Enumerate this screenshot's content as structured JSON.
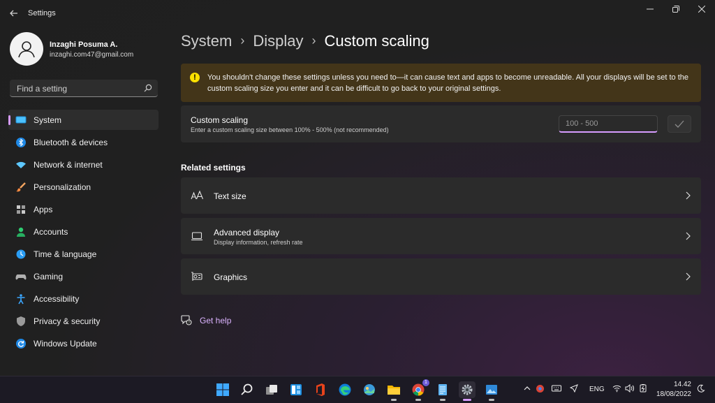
{
  "window": {
    "title": "Settings"
  },
  "profile": {
    "name": "Inzaghi Posuma A.",
    "email": "inzaghi.com47@gmail.com"
  },
  "search": {
    "placeholder": "Find a setting"
  },
  "sidebar": {
    "items": [
      {
        "label": "System",
        "icon": "system-icon",
        "active": true
      },
      {
        "label": "Bluetooth & devices",
        "icon": "bluetooth-icon"
      },
      {
        "label": "Network & internet",
        "icon": "wifi-icon"
      },
      {
        "label": "Personalization",
        "icon": "brush-icon"
      },
      {
        "label": "Apps",
        "icon": "apps-icon"
      },
      {
        "label": "Accounts",
        "icon": "accounts-icon"
      },
      {
        "label": "Time & language",
        "icon": "globe-clock-icon"
      },
      {
        "label": "Gaming",
        "icon": "gamepad-icon"
      },
      {
        "label": "Accessibility",
        "icon": "accessibility-icon"
      },
      {
        "label": "Privacy & security",
        "icon": "shield-icon"
      },
      {
        "label": "Windows Update",
        "icon": "update-icon"
      }
    ]
  },
  "breadcrumb": {
    "items": [
      "System",
      "Display",
      "Custom scaling"
    ]
  },
  "warning": {
    "text": "You shouldn't change these settings unless you need to—it can cause text and apps to become unreadable. All your displays will be set to the custom scaling size you enter and it can be difficult to go back to your original settings."
  },
  "custom_scaling": {
    "title": "Custom scaling",
    "subtitle": "Enter a custom scaling size between 100% - 500% (not recommended)",
    "placeholder": "100 - 500"
  },
  "related": {
    "heading": "Related settings",
    "items": [
      {
        "title": "Text size",
        "subtitle": "",
        "icon": "text-size-icon"
      },
      {
        "title": "Advanced display",
        "subtitle": "Display information, refresh rate",
        "icon": "laptop-icon"
      },
      {
        "title": "Graphics",
        "subtitle": "",
        "icon": "graphics-card-icon"
      }
    ]
  },
  "help": {
    "label": "Get help"
  },
  "taskbar": {
    "apps": [
      "windows-start-icon",
      "search-icon",
      "task-view-icon",
      "widgets-icon",
      "office-icon",
      "edge-icon",
      "photos-icon",
      "file-explorer-icon",
      "chrome-icon",
      "notepad-icon",
      "settings-icon",
      "image-viewer-icon"
    ],
    "chrome_badge": "1",
    "language": "ENG",
    "time": "14.42",
    "date": "18/08/2022"
  },
  "colors": {
    "accent": "#d79cff",
    "warning_bg": "#433519",
    "warning_icon": "#fce100",
    "card_bg": "#2b2b2b"
  }
}
